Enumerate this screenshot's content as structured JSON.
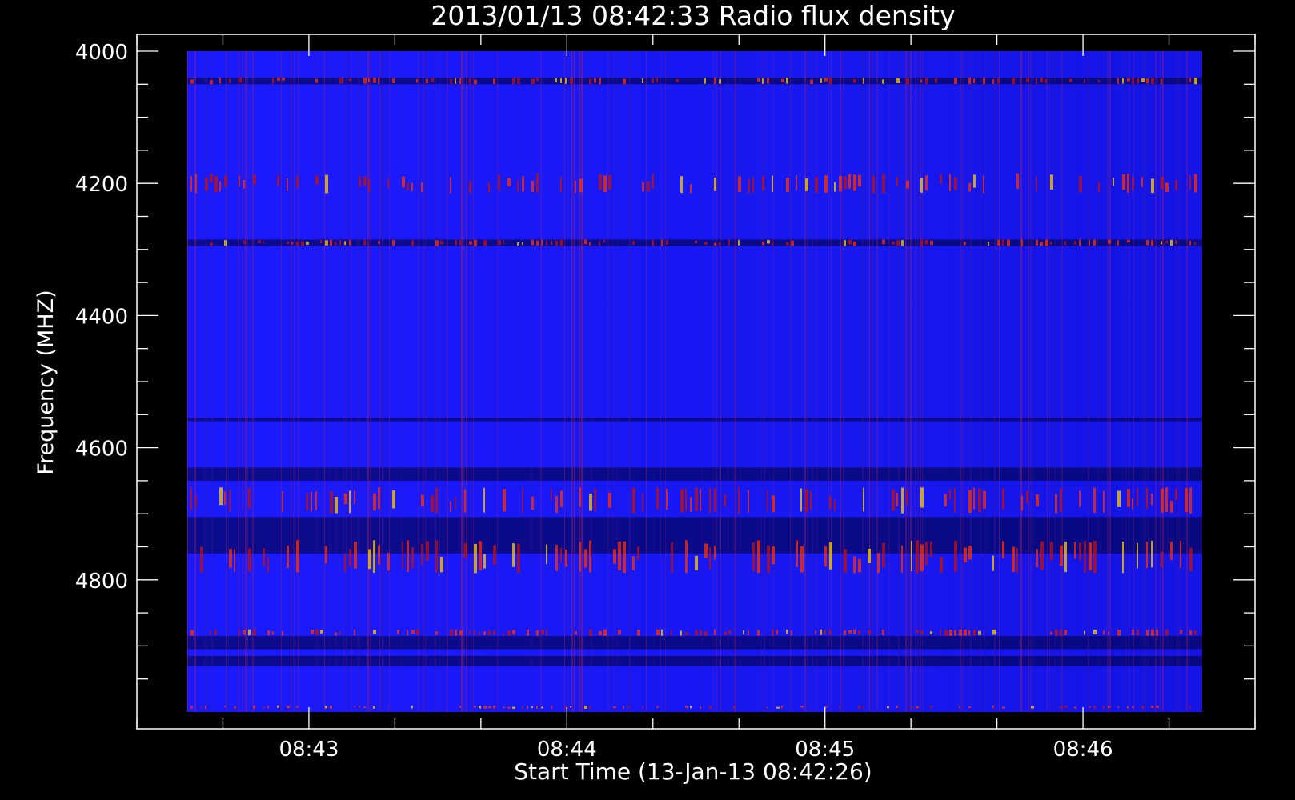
{
  "chart_data": {
    "type": "heatmap",
    "title": "2013/01/13 08:42:33 Radio flux density",
    "xlabel": "Start Time (13-Jan-13 08:42:26)",
    "ylabel": "Frequency (MHZ)",
    "x_range": [
      "08:42:26",
      "08:46:41"
    ],
    "xlim": [
      "08:42:20",
      "08:46:40"
    ],
    "ylim": [
      4000,
      5000
    ],
    "y_direction": "inverted",
    "x_major_ticks": [
      {
        "time": "08:43",
        "label": "08:43"
      },
      {
        "time": "08:44",
        "label": "08:44"
      },
      {
        "time": "08:45",
        "label": "08:45"
      },
      {
        "time": "08:46",
        "label": "08:46"
      }
    ],
    "y_major_ticks": [
      {
        "value": 4000,
        "label": "4000"
      },
      {
        "value": 4200,
        "label": "4200"
      },
      {
        "value": 4400,
        "label": "4400"
      },
      {
        "value": 4600,
        "label": "4600"
      },
      {
        "value": 4800,
        "label": "4800"
      }
    ],
    "colormap": [
      "#000010",
      "#1010ff",
      "#ff2200",
      "#ffff00"
    ],
    "background_color": "#1414f0",
    "bright_horizontal_bands_mhz": [
      {
        "from": 4040,
        "to": 4050
      },
      {
        "from": 4185,
        "to": 4215
      },
      {
        "from": 4285,
        "to": 4295
      },
      {
        "from": 4660,
        "to": 4700
      },
      {
        "from": 4740,
        "to": 4790
      },
      {
        "from": 4875,
        "to": 4885
      },
      {
        "from": 4990,
        "to": 4995
      }
    ],
    "dark_horizontal_bands_mhz": [
      {
        "from": 4040,
        "to": 4050
      },
      {
        "from": 4285,
        "to": 4295
      },
      {
        "from": 4555,
        "to": 4560
      },
      {
        "from": 4630,
        "to": 4650
      },
      {
        "from": 4705,
        "to": 4730
      },
      {
        "from": 4730,
        "to": 4760
      },
      {
        "from": 4885,
        "to": 4905
      },
      {
        "from": 4915,
        "to": 4930
      }
    ]
  }
}
